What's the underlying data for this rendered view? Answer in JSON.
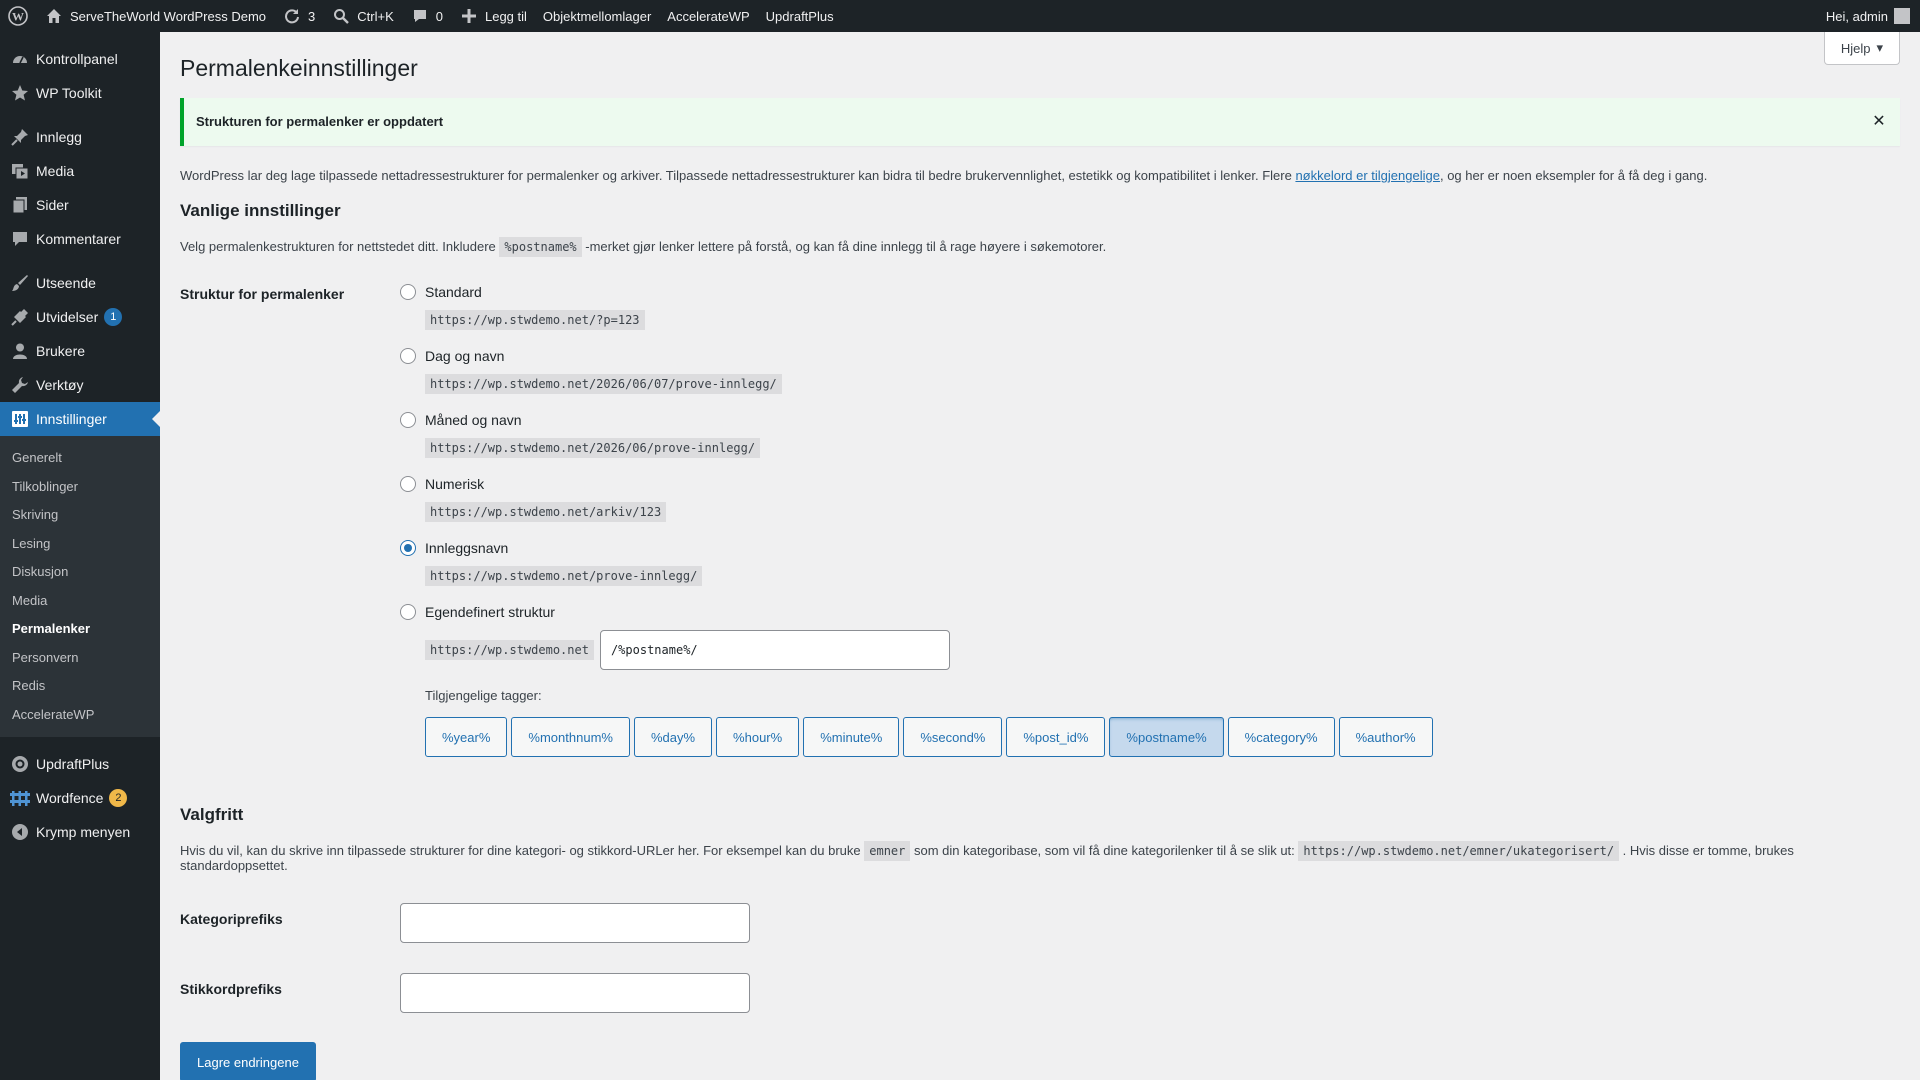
{
  "admin_bar": {
    "site_name": "ServeTheWorld WordPress Demo",
    "updates_count": "3",
    "search_shortcut": "Ctrl+K",
    "comments_count": "0",
    "new_label": "Legg til",
    "items": [
      "Objektmellomlager",
      "AccelerateWP",
      "UpdraftPlus"
    ],
    "greeting": "Hei, admin"
  },
  "sidebar": {
    "items": [
      {
        "label": "Kontrollpanel",
        "icon": "dashboard-icon"
      },
      {
        "label": "WP Toolkit",
        "icon": "star-icon"
      },
      {
        "label": "Innlegg",
        "icon": "pin-icon"
      },
      {
        "label": "Media",
        "icon": "media-icon"
      },
      {
        "label": "Sider",
        "icon": "page-icon"
      },
      {
        "label": "Kommentarer",
        "icon": "comment-icon"
      },
      {
        "label": "Utseende",
        "icon": "brush-icon"
      },
      {
        "label": "Utvidelser",
        "icon": "plugin-icon",
        "badge": "1"
      },
      {
        "label": "Brukere",
        "icon": "user-icon"
      },
      {
        "label": "Verktøy",
        "icon": "wrench-icon"
      },
      {
        "label": "Innstillinger",
        "icon": "settings-icon"
      },
      {
        "label": "UpdraftPlus",
        "icon": "updraft-icon"
      },
      {
        "label": "Wordfence",
        "icon": "wordfence-icon",
        "badge": "2"
      },
      {
        "label": "Krymp menyen",
        "icon": "collapse-icon"
      }
    ],
    "submenu": [
      "Generelt",
      "Tilkoblinger",
      "Skriving",
      "Lesing",
      "Diskusjon",
      "Media",
      "Permalenker",
      "Personvern",
      "Redis",
      "AccelerateWP"
    ]
  },
  "help_label": "Hjelp",
  "page_title": "Permalenkeinnstillinger",
  "notice": "Strukturen for permalenker er oppdatert",
  "intro": {
    "before": "WordPress lar deg lage tilpassede nettadressestrukturer for permalenker og arkiver. Tilpassede nettadressestrukturer kan bidra til bedre brukervennlighet, estetikk og kompatibilitet i lenker. Flere ",
    "link": "nøkkelord er tilgjengelige",
    "after": ", og her er noen eksempler for å få deg i gang."
  },
  "common": {
    "heading": "Vanlige innstillinger",
    "desc_before": "Velg permalenkestrukturen for nettstedet ditt. Inkludere ",
    "desc_code": "%postname%",
    "desc_after": " -merket gjør lenker lettere på forstå, og kan få dine innlegg til å rage høyere i søkemotorer.",
    "field_label": "Struktur for permalenker",
    "options": [
      {
        "label": "Standard",
        "example": "https://wp.stwdemo.net/?p=123",
        "checked": false
      },
      {
        "label": "Dag og navn",
        "example": "https://wp.stwdemo.net/2026/06/07/prove-innlegg/",
        "checked": false
      },
      {
        "label": "Måned og navn",
        "example": "https://wp.stwdemo.net/2026/06/prove-innlegg/",
        "checked": false
      },
      {
        "label": "Numerisk",
        "example": "https://wp.stwdemo.net/arkiv/123",
        "checked": false
      },
      {
        "label": "Innleggsnavn",
        "example": "https://wp.stwdemo.net/prove-innlegg/",
        "checked": true
      }
    ],
    "custom": {
      "label": "Egendefinert struktur",
      "base": "https://wp.stwdemo.net",
      "value": "/%postname%/"
    },
    "tags_label": "Tilgjengelige tagger:",
    "tags": [
      "%year%",
      "%monthnum%",
      "%day%",
      "%hour%",
      "%minute%",
      "%second%",
      "%post_id%",
      "%postname%",
      "%category%",
      "%author%"
    ],
    "active_tag": "%postname%"
  },
  "optional": {
    "heading": "Valgfritt",
    "desc_before": "Hvis du vil, kan du skrive inn tilpassede strukturer for dine kategori- og stikkord-URLer her. For eksempel kan du bruke ",
    "desc_code1": "emner",
    "desc_middle": " som din kategoribase, som vil få dine kategorilenker til å se slik ut: ",
    "desc_code2": "https://wp.stwdemo.net/emner/ukategorisert/",
    "desc_after": " . Hvis disse er tomme, brukes standardoppsettet.",
    "category_label": "Kategoriprefiks",
    "tag_label": "Stikkordprefiks"
  },
  "save_label": "Lagre endringene",
  "colors": {
    "accent": "#2271b1",
    "adminbar": "#1d2327",
    "success": "#00a32a",
    "badge_orange": "#f0b849"
  }
}
